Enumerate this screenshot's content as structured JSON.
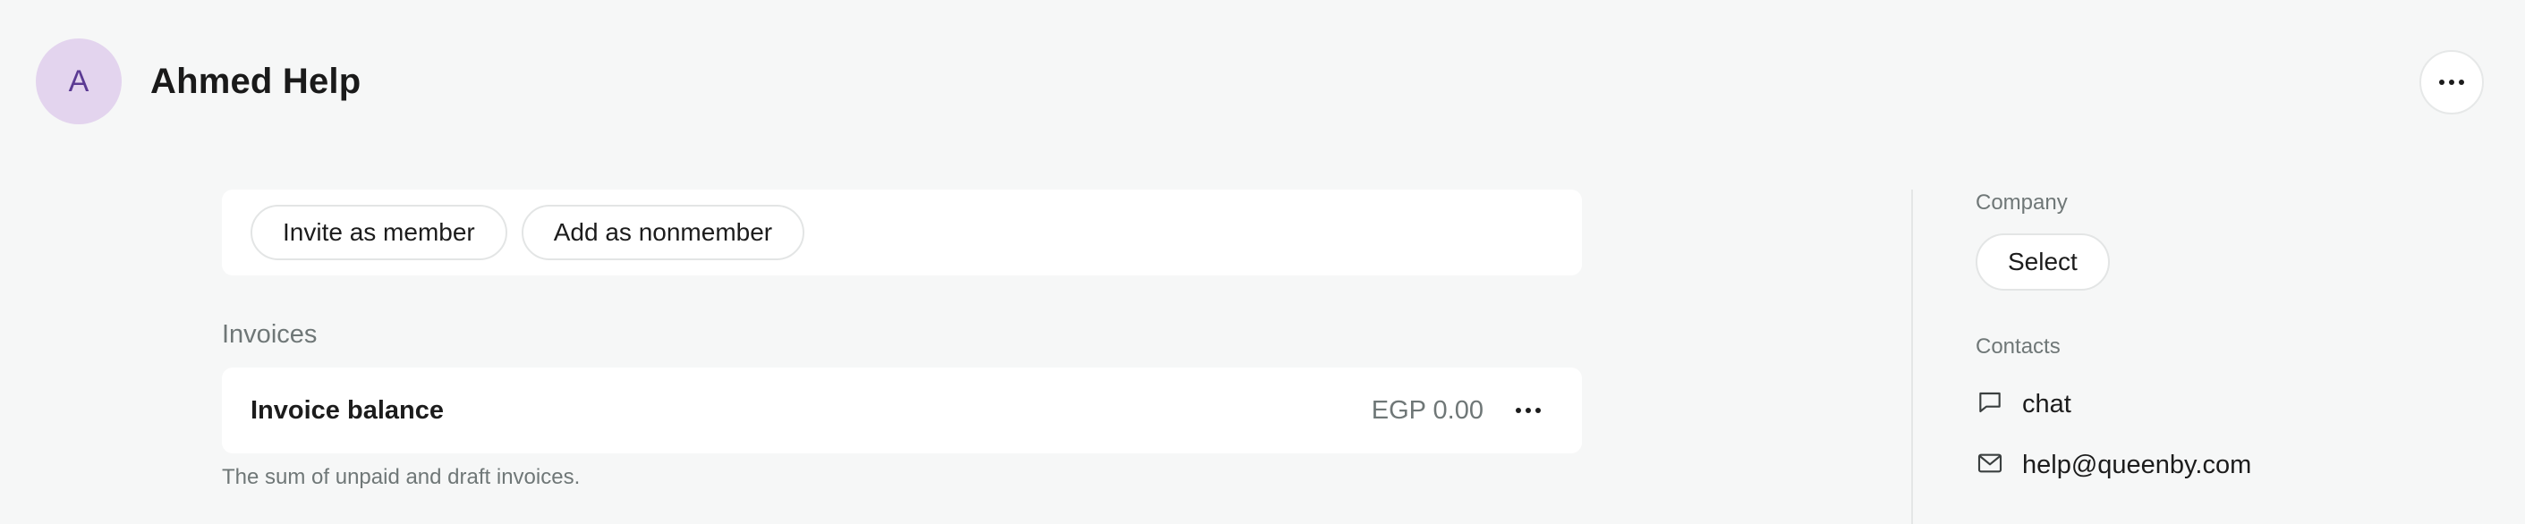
{
  "header": {
    "avatar_initial": "A",
    "title": "Ahmed Help",
    "more_icon": "more-horizontal-icon"
  },
  "actions": {
    "invite_label": "Invite as member",
    "add_label": "Add as nonmember"
  },
  "invoices": {
    "section_label": "Invoices",
    "balance_label": "Invoice balance",
    "balance_amount": "EGP 0.00",
    "hint": "The sum of unpaid and draft invoices."
  },
  "sidebar": {
    "company_label": "Company",
    "company_select": "Select",
    "contacts_label": "Contacts",
    "contacts": [
      {
        "icon": "chat-bubble-icon",
        "text": "chat"
      },
      {
        "icon": "mail-icon",
        "text": "help@queenby.com"
      }
    ]
  },
  "colors": {
    "background": "#f6f7f7",
    "card": "#ffffff",
    "avatar_bg": "#e3d4ee",
    "avatar_text": "#5b3a93",
    "muted_text": "#6f7777"
  }
}
